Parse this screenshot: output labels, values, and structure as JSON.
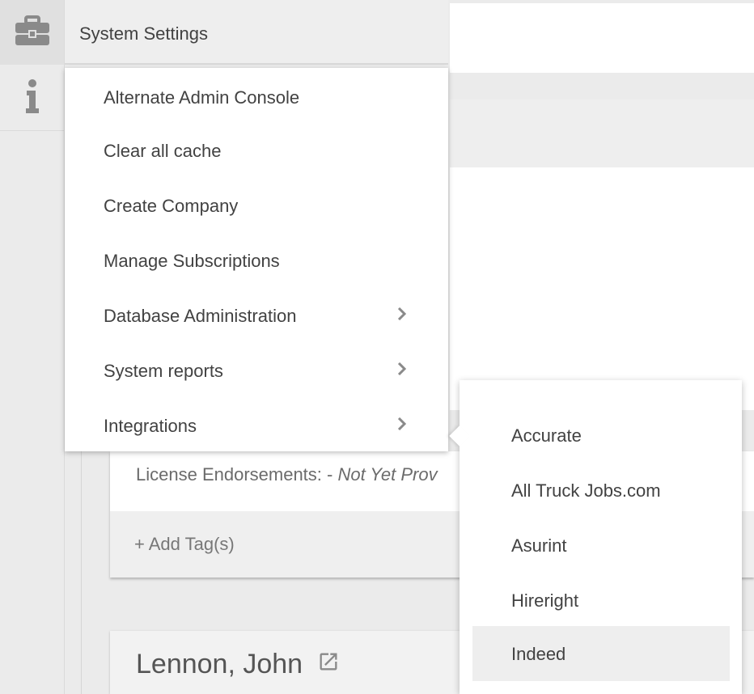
{
  "header": {
    "title": "System Settings"
  },
  "menu": {
    "items": [
      {
        "label": "Alternate Admin Console",
        "has_submenu": false
      },
      {
        "label": "Clear all cache",
        "has_submenu": false
      },
      {
        "label": "Create Company",
        "has_submenu": false
      },
      {
        "label": "Manage Subscriptions",
        "has_submenu": false
      },
      {
        "label": "Database Administration",
        "has_submenu": true
      },
      {
        "label": "System reports",
        "has_submenu": true
      },
      {
        "label": "Integrations",
        "has_submenu": true
      }
    ]
  },
  "submenu": {
    "items": [
      {
        "label": "Accurate"
      },
      {
        "label": "All Truck Jobs.com"
      },
      {
        "label": "Asurint"
      },
      {
        "label": "Hireright"
      },
      {
        "label": "Indeed",
        "active": true
      }
    ]
  },
  "card": {
    "license_label": "License Endorsements: - ",
    "license_value": "Not Yet Prov",
    "add_tag": "+ Add Tag(s)"
  },
  "card2": {
    "name": "Lennon, John"
  },
  "icons": {
    "rail": [
      "briefcase-icon",
      "info-icon"
    ],
    "chevron": "chevron-right-icon",
    "external": "external-link-icon"
  },
  "colors": {
    "icon": "#8a8a8a",
    "menu_text": "#424242",
    "active_bg": "#eeeeee"
  }
}
